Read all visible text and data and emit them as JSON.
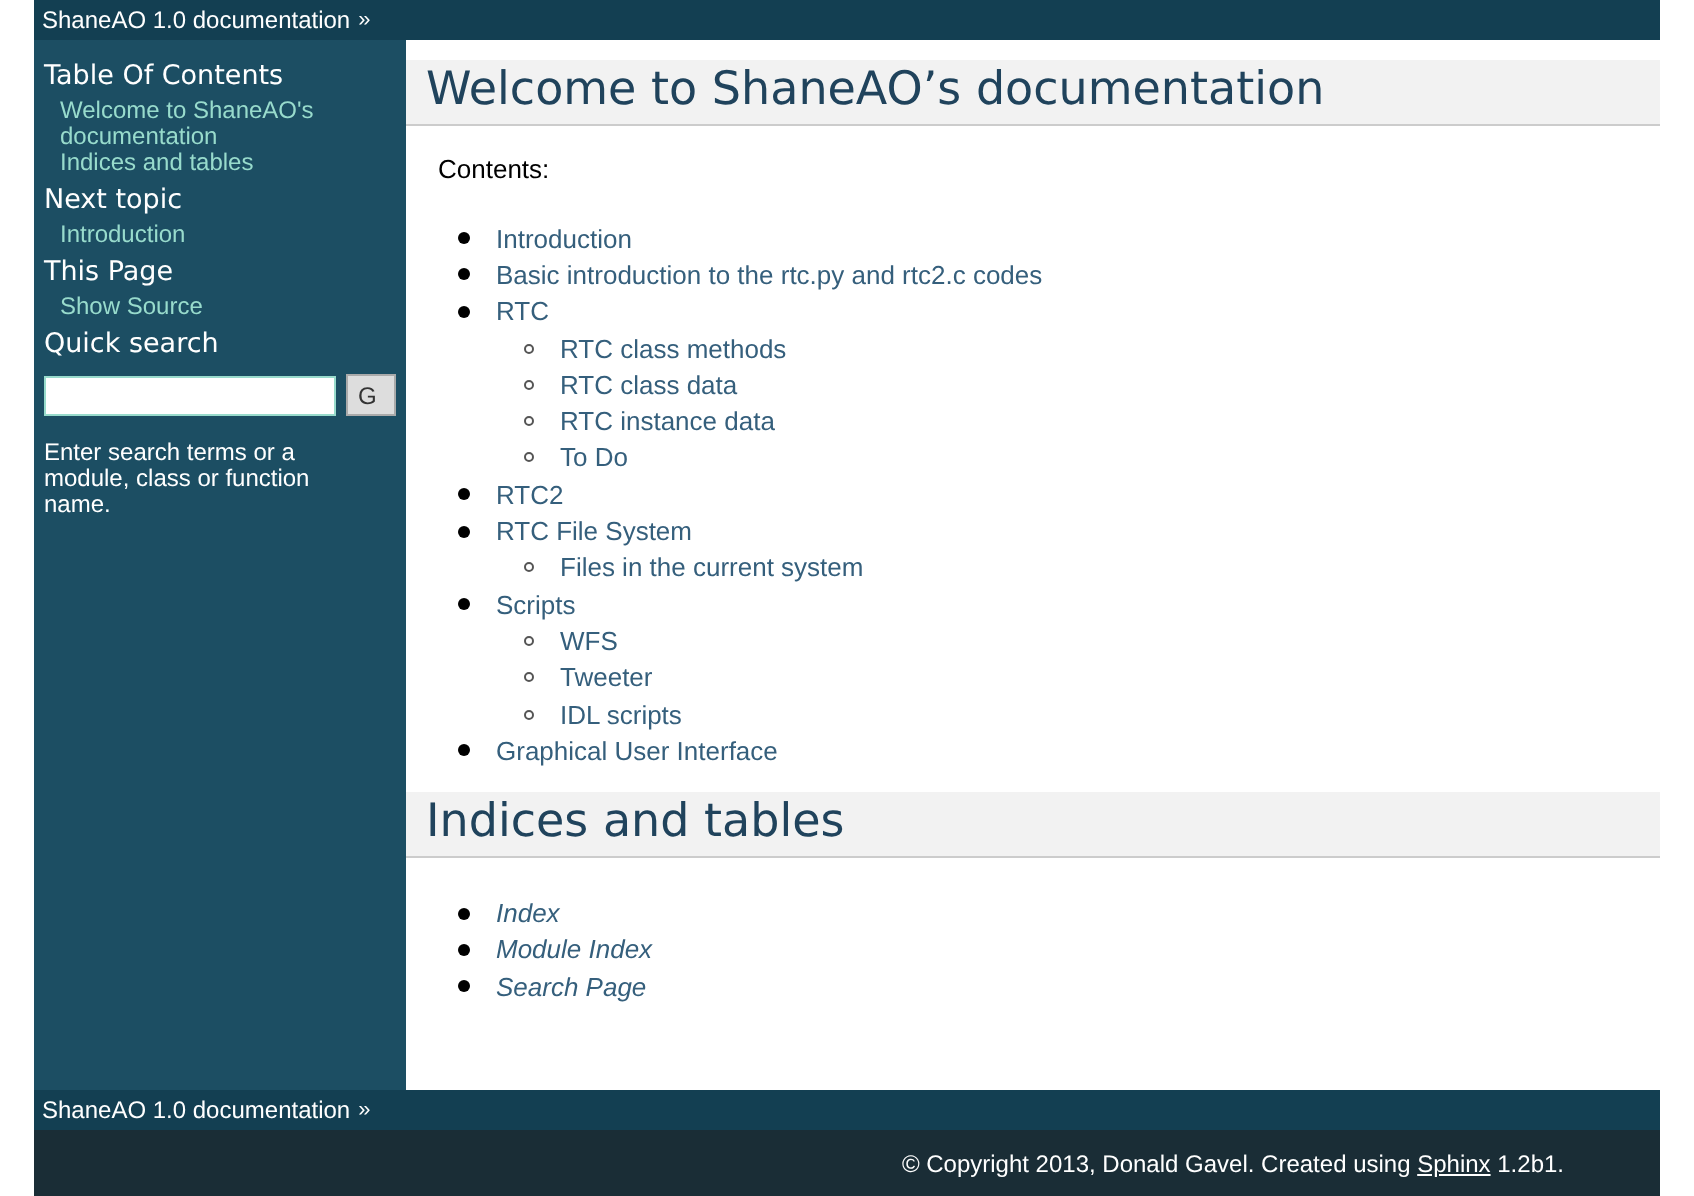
{
  "top_bar": {
    "link": "ShaneAO 1.0 documentation",
    "arrow": "»"
  },
  "sidebar": {
    "sections": [
      {
        "heading": "Table Of Contents",
        "links": [
          "Welcome to ShaneAO's documentation",
          "Indices and tables"
        ]
      },
      {
        "heading": "Next topic",
        "links": [
          "Introduction"
        ]
      },
      {
        "heading": "This Page",
        "links": [
          "Show Source"
        ]
      }
    ],
    "search": {
      "heading": "Quick search",
      "button": "G",
      "hint": "Enter search terms or a module, class or function name."
    }
  },
  "content": {
    "sections": [
      {
        "title": "Welcome to ShaneAO’s documentation",
        "intro": "Contents:",
        "items": [
          {
            "text": "Introduction",
            "italic": false
          },
          {
            "text": "Basic introduction to the rtc.py and rtc2.c codes",
            "italic": false
          },
          {
            "text": "RTC",
            "italic": false,
            "children": [
              {
                "text": "RTC class methods",
                "italic": false
              },
              {
                "text": "RTC class data",
                "italic": false
              },
              {
                "text": "RTC instance data",
                "italic": false
              },
              {
                "text": "To Do",
                "italic": false
              }
            ]
          },
          {
            "text": "RTC2",
            "italic": false
          },
          {
            "text": "RTC File System",
            "italic": false,
            "children": [
              {
                "text": "Files in the current system",
                "italic": false
              }
            ]
          },
          {
            "text": "Scripts",
            "italic": false,
            "children": [
              {
                "text": "WFS",
                "italic": false
              },
              {
                "text": "Tweeter",
                "italic": false
              },
              {
                "text": "IDL scripts",
                "italic": false
              }
            ]
          },
          {
            "text": "Graphical User Interface",
            "italic": false
          }
        ]
      },
      {
        "title": "Indices and tables",
        "items": [
          {
            "text": "Index",
            "italic": true
          },
          {
            "text": "Module Index",
            "italic": true
          },
          {
            "text": "Search Page",
            "italic": true
          }
        ]
      }
    ]
  },
  "bottom_bar": {
    "link": "ShaneAO 1.0 documentation",
    "arrow": "»"
  },
  "footer": {
    "before": "© Copyright 2013, Donald Gavel. Created using ",
    "link": "Sphinx",
    "after": " 1.2b1."
  }
}
